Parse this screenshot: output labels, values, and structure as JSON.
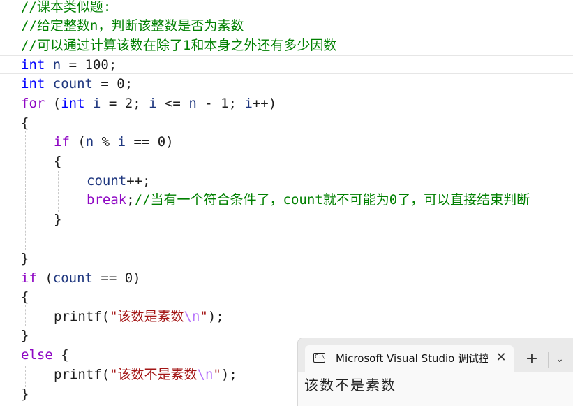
{
  "code": {
    "l1_comment": "//课本类似题:",
    "l2_comment": "//给定整数n，判断该整数是否为素数",
    "l3_comment": "//可以通过计算该数在除了1和本身之外还有多少因数",
    "l4": {
      "kw": "int",
      "var": "n",
      "rest": " = 100;"
    },
    "l5": {
      "kw": "int",
      "var": "count",
      "rest": " = 0;"
    },
    "l6": {
      "ctl": "for",
      "a": " (",
      "kw": "int",
      "var1": "i",
      "b": " = 2; ",
      "var2": "i",
      "c": " <= ",
      "var3": "n",
      "d": " - 1; ",
      "var4": "i",
      "e": "++)"
    },
    "l7": "{",
    "l8": {
      "ctl": "if",
      "a": " (",
      "var1": "n",
      "b": " % ",
      "var2": "i",
      "c": " == 0)"
    },
    "l9": "{",
    "l10": {
      "var": "count",
      "rest": "++;"
    },
    "l11": {
      "ctl": "break",
      "semi": ";",
      "comment": "//当有一个符合条件了，count就不可能为0了，可以直接结束判断"
    },
    "l12": "}",
    "l14": "}",
    "l15": {
      "ctl": "if",
      "a": " (",
      "var": "count",
      "b": " == 0)"
    },
    "l16": "{",
    "l17": {
      "fn": "printf(",
      "str": "\"该数是素数",
      "esc": "\\n",
      "strEnd": "\"",
      "end": ");"
    },
    "l18": "}",
    "l19": {
      "ctl": "else",
      "rest": " {"
    },
    "l20": {
      "fn": "printf(",
      "str": "\"该数不是素数",
      "esc": "\\n",
      "strEnd": "\"",
      "end": ");"
    },
    "l21": "}"
  },
  "terminal": {
    "tab_title": "Microsoft Visual Studio 调试控制台",
    "icon_text": "C:\\",
    "close_glyph": "✕",
    "plus_glyph": "+",
    "chevron_glyph": "⌄",
    "output": "该数不是素数"
  }
}
